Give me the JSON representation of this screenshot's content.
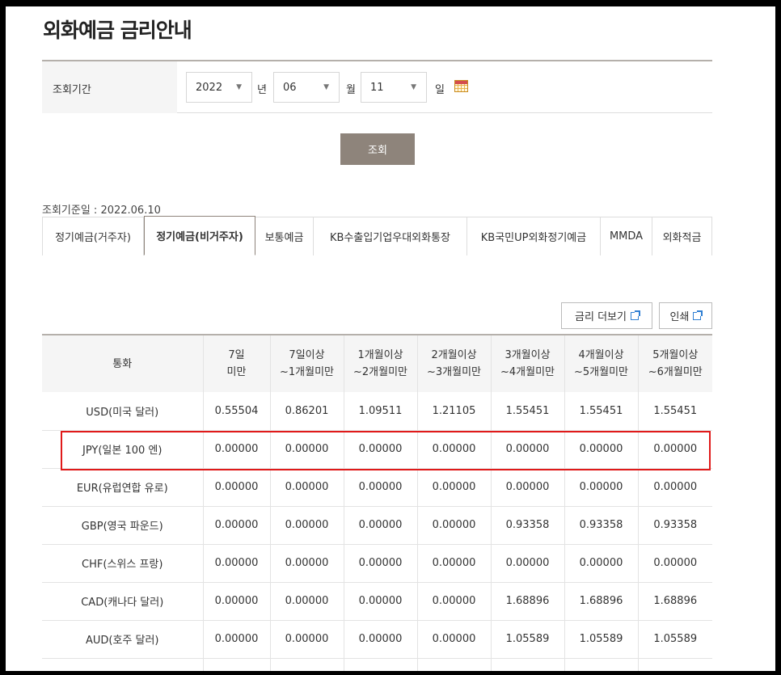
{
  "page": {
    "title": "외화예금 금리안내"
  },
  "search": {
    "label": "조회기간",
    "year": "2022",
    "year_unit": "년",
    "month": "06",
    "month_unit": "월",
    "day": "11",
    "day_unit": "일",
    "button": "조회"
  },
  "base_date": "조회기준일 : 2022.06.10",
  "tabs": [
    {
      "label": "정기예금(거주자)",
      "active": false
    },
    {
      "label": "정기예금(비거주자)",
      "active": true
    },
    {
      "label": "보통예금",
      "active": false
    },
    {
      "label": "KB수출입기업우대외화통장",
      "active": false
    },
    {
      "label": "KB국민UP외화정기예금",
      "active": false
    },
    {
      "label": "MMDA",
      "active": false
    },
    {
      "label": "외화적금",
      "active": false
    }
  ],
  "tools": {
    "more_rates": "금리 더보기",
    "print": "인쇄"
  },
  "table": {
    "headers": [
      [
        "통화"
      ],
      [
        "7일",
        "미만"
      ],
      [
        "7일이상",
        "~1개월미만"
      ],
      [
        "1개월이상",
        "~2개월미만"
      ],
      [
        "2개월이상",
        "~3개월미만"
      ],
      [
        "3개월이상",
        "~4개월미만"
      ],
      [
        "4개월이상",
        "~5개월미만"
      ],
      [
        "5개월이상",
        "~6개월미만"
      ]
    ],
    "rows": [
      [
        "USD(미국 달러)",
        "0.55504",
        "0.86201",
        "1.09511",
        "1.21105",
        "1.55451",
        "1.55451",
        "1.55451"
      ],
      [
        "JPY(일본 100 엔)",
        "0.00000",
        "0.00000",
        "0.00000",
        "0.00000",
        "0.00000",
        "0.00000",
        "0.00000"
      ],
      [
        "EUR(유럽연합 유로)",
        "0.00000",
        "0.00000",
        "0.00000",
        "0.00000",
        "0.00000",
        "0.00000",
        "0.00000"
      ],
      [
        "GBP(영국 파운드)",
        "0.00000",
        "0.00000",
        "0.00000",
        "0.00000",
        "0.93358",
        "0.93358",
        "0.93358"
      ],
      [
        "CHF(스위스 프랑)",
        "0.00000",
        "0.00000",
        "0.00000",
        "0.00000",
        "0.00000",
        "0.00000",
        "0.00000"
      ],
      [
        "CAD(캐나다 달러)",
        "0.00000",
        "0.00000",
        "0.00000",
        "0.00000",
        "1.68896",
        "1.68896",
        "1.68896"
      ],
      [
        "AUD(호주 달러)",
        "0.00000",
        "0.00000",
        "0.00000",
        "0.00000",
        "1.05589",
        "1.05589",
        "1.05589"
      ],
      [
        "",
        "",
        "",
        "",
        "",
        "",
        "",
        ""
      ]
    ]
  },
  "colors": {
    "highlight": "#e01a1a",
    "button_bg": "#8e847b"
  }
}
